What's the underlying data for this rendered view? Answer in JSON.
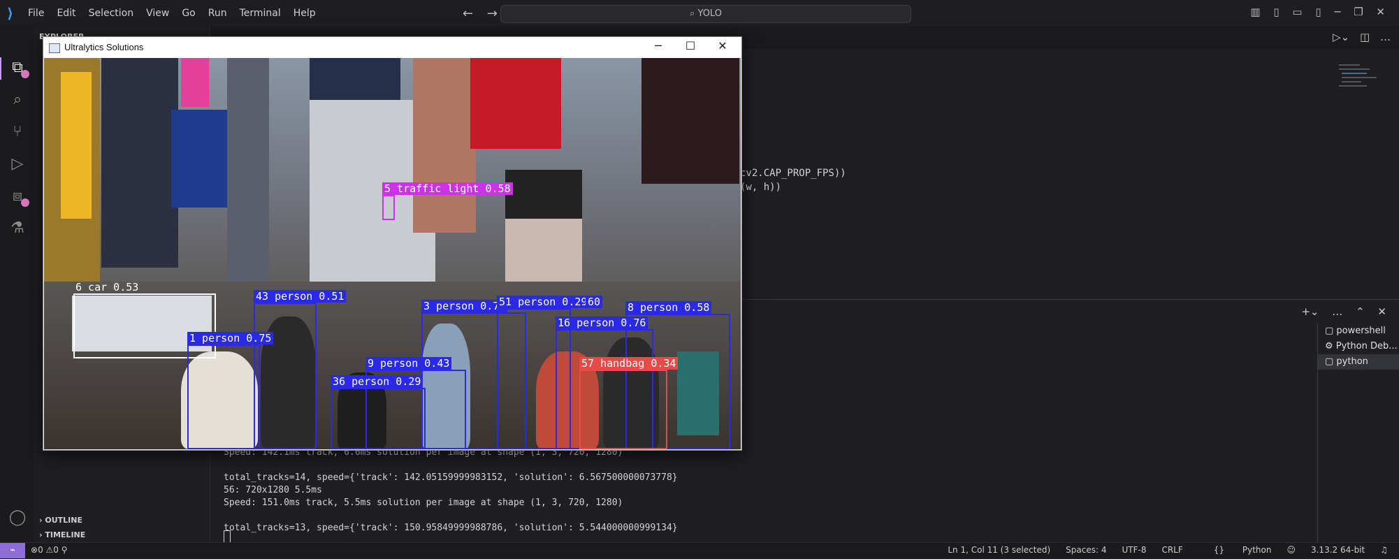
{
  "titlebar": {
    "menu": [
      "File",
      "Edit",
      "Selection",
      "View",
      "Go",
      "Run",
      "Terminal",
      "Help"
    ],
    "search": "YOLO"
  },
  "editor": {
    "lines": [
      "cv2.CAP_PROP_FPS))",
      "(w, h))"
    ]
  },
  "sidebar": {
    "explorer": "EXPLORER",
    "outline": "OUTLINE",
    "timeline": "TIMELINE"
  },
  "cv_window": {
    "title": "Ultralytics Solutions",
    "detections": [
      {
        "label": "5 traffic light 0.58",
        "color": "#cc33e6"
      },
      {
        "label": "6 car 0.53",
        "color": "#ffffff"
      },
      {
        "label": "43 person 0.51",
        "color": "#2929e6"
      },
      {
        "label": "1 person 0.75",
        "color": "#2929e6"
      },
      {
        "label": "3 person 0.75",
        "color": "#2929e6"
      },
      {
        "label": "51 person 0.29",
        "color": "#2929e6"
      },
      {
        "label": "60",
        "color": "#2929e6"
      },
      {
        "label": "8 person 0.58",
        "color": "#2929e6"
      },
      {
        "label": "16 person 0.76",
        "color": "#2929e6"
      },
      {
        "label": "9 person 0.43",
        "color": "#2929e6"
      },
      {
        "label": "36 person 0.29",
        "color": "#2929e6"
      },
      {
        "label": "57 handbag 0.34",
        "color": "#e84a4a"
      }
    ]
  },
  "terminal": {
    "lines": [
      "Speed: 142.1ms track, 6.6ms solution per image at shape (1, 3, 720, 1280)",
      "",
      "total_tracks=14, speed={'track': 142.05159999983152, 'solution': 6.567500000073778}",
      "56: 720x1280 5.5ms",
      "Speed: 151.0ms track, 5.5ms solution per image at shape (1, 3, 720, 1280)",
      "",
      "total_tracks=13, speed={'track': 150.95849999988786, 'solution': 5.544000000999134}"
    ],
    "tabs": [
      "powershell",
      "Python Deb...",
      "python"
    ]
  },
  "statusbar": {
    "errors": "0",
    "warnings": "0",
    "position": "Ln 1, Col 11 (3 selected)",
    "spaces": "Spaces: 4",
    "encoding": "UTF-8",
    "eol": "CRLF",
    "language": "Python",
    "interpreter": "3.13.2 64-bit"
  }
}
